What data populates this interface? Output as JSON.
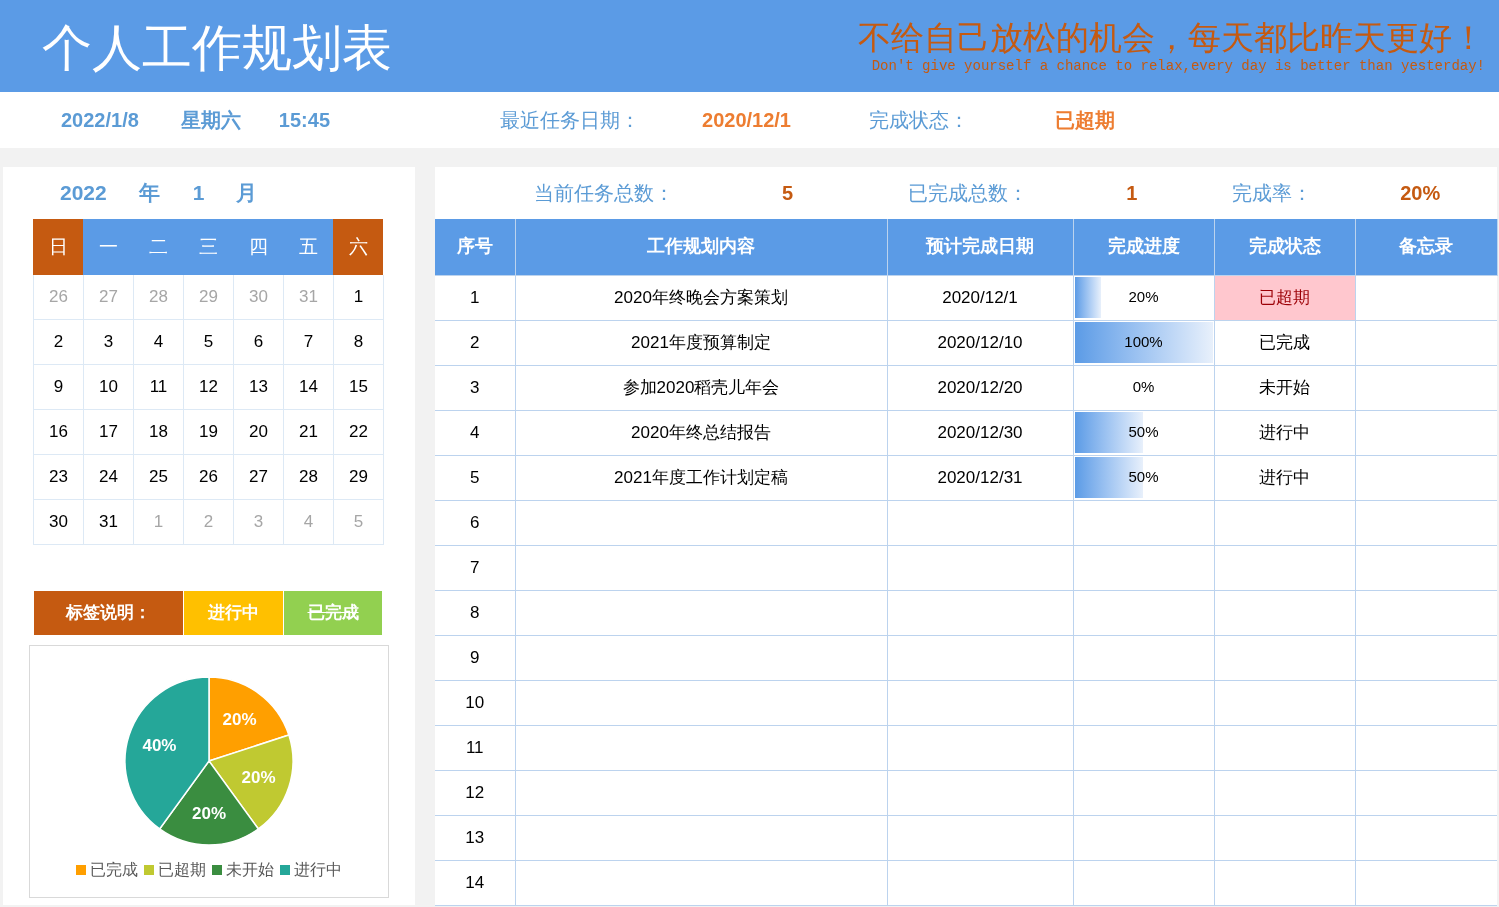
{
  "header": {
    "title": "个人工作规划表",
    "motto": "不给自己放松的机会，每天都比昨天更好！",
    "motto_en": "Don't give yourself a chance to relax,every day is better than yesterday!"
  },
  "info_bar": {
    "date": "2022/1/8",
    "weekday": "星期六",
    "time": "15:45",
    "recent_label": "最近任务日期：",
    "recent_value": "2020/12/1",
    "status_label": "完成状态：",
    "status_value": "已超期"
  },
  "calendar": {
    "year": "2022",
    "year_unit": "年",
    "month": "1",
    "month_unit": "月",
    "weekdays": [
      {
        "label": "日",
        "weekend": true
      },
      {
        "label": "一",
        "weekend": false
      },
      {
        "label": "二",
        "weekend": false
      },
      {
        "label": "三",
        "weekend": false
      },
      {
        "label": "四",
        "weekend": false
      },
      {
        "label": "五",
        "weekend": false
      },
      {
        "label": "六",
        "weekend": true
      }
    ],
    "weeks": [
      [
        {
          "day": "26",
          "muted": true
        },
        {
          "day": "27",
          "muted": true
        },
        {
          "day": "28",
          "muted": true
        },
        {
          "day": "29",
          "muted": true
        },
        {
          "day": "30",
          "muted": true
        },
        {
          "day": "31",
          "muted": true
        },
        {
          "day": "1",
          "muted": false
        }
      ],
      [
        {
          "day": "2",
          "muted": false
        },
        {
          "day": "3",
          "muted": false
        },
        {
          "day": "4",
          "muted": false
        },
        {
          "day": "5",
          "muted": false
        },
        {
          "day": "6",
          "muted": false
        },
        {
          "day": "7",
          "muted": false
        },
        {
          "day": "8",
          "muted": false
        }
      ],
      [
        {
          "day": "9",
          "muted": false
        },
        {
          "day": "10",
          "muted": false
        },
        {
          "day": "11",
          "muted": false
        },
        {
          "day": "12",
          "muted": false
        },
        {
          "day": "13",
          "muted": false
        },
        {
          "day": "14",
          "muted": false
        },
        {
          "day": "15",
          "muted": false
        }
      ],
      [
        {
          "day": "16",
          "muted": false
        },
        {
          "day": "17",
          "muted": false
        },
        {
          "day": "18",
          "muted": false
        },
        {
          "day": "19",
          "muted": false
        },
        {
          "day": "20",
          "muted": false
        },
        {
          "day": "21",
          "muted": false
        },
        {
          "day": "22",
          "muted": false
        }
      ],
      [
        {
          "day": "23",
          "muted": false
        },
        {
          "day": "24",
          "muted": false
        },
        {
          "day": "25",
          "muted": false
        },
        {
          "day": "26",
          "muted": false
        },
        {
          "day": "27",
          "muted": false
        },
        {
          "day": "28",
          "muted": false
        },
        {
          "day": "29",
          "muted": false
        }
      ],
      [
        {
          "day": "30",
          "muted": false
        },
        {
          "day": "31",
          "muted": false
        },
        {
          "day": "1",
          "muted": true
        },
        {
          "day": "2",
          "muted": true
        },
        {
          "day": "3",
          "muted": true
        },
        {
          "day": "4",
          "muted": true
        },
        {
          "day": "5",
          "muted": true
        }
      ]
    ]
  },
  "tag_legend": [
    {
      "label": "标签说明：",
      "kind": "title"
    },
    {
      "label": "进行中",
      "kind": "active"
    },
    {
      "label": "已完成",
      "kind": "done"
    }
  ],
  "chart_data": {
    "type": "pie",
    "categories": [
      "已完成",
      "已超期",
      "未开始",
      "进行中"
    ],
    "values": [
      20,
      20,
      20,
      40
    ],
    "colors": [
      "#ff9f00",
      "#c0c931",
      "#3a8d40",
      "#25a799"
    ],
    "data_labels": true,
    "value_labels": [
      "20%",
      "20%",
      "20%",
      "40%"
    ]
  },
  "summary": [
    {
      "label": "当前任务总数：",
      "value": "5"
    },
    {
      "label": "已完成总数：",
      "value": "1"
    },
    {
      "label": "完成率：",
      "value": "20%"
    }
  ],
  "table": {
    "columns": [
      "序号",
      "工作规划内容",
      "预计完成日期",
      "完成进度",
      "完成状态",
      "备忘录"
    ],
    "rows": [
      {
        "no": "1",
        "content": "2020年终晚会方案策划",
        "due": "2020/12/1",
        "level": 0.2,
        "progress": "20%",
        "status": "已超期",
        "highlighted": true
      },
      {
        "no": "2",
        "content": "2021年度预算制定",
        "due": "2020/12/10",
        "level": 1,
        "progress": "100%",
        "status": "已完成",
        "highlighted": false
      },
      {
        "no": "3",
        "content": "参加2020稻壳儿年会",
        "due": "2020/12/20",
        "level": 0,
        "progress": "0%",
        "status": "未开始",
        "highlighted": false
      },
      {
        "no": "4",
        "content": "2020年终总结报告",
        "due": "2020/12/30",
        "level": 0.5,
        "progress": "50%",
        "status": "进行中",
        "highlighted": false
      },
      {
        "no": "5",
        "content": "2021年度工作计划定稿",
        "due": "2020/12/31",
        "level": 0.5,
        "progress": "50%",
        "status": "进行中",
        "highlighted": false
      },
      {
        "no": "6"
      },
      {
        "no": "7"
      },
      {
        "no": "8"
      },
      {
        "no": "9"
      },
      {
        "no": "10"
      },
      {
        "no": "11"
      },
      {
        "no": "12"
      },
      {
        "no": "13"
      },
      {
        "no": "14"
      }
    ]
  }
}
